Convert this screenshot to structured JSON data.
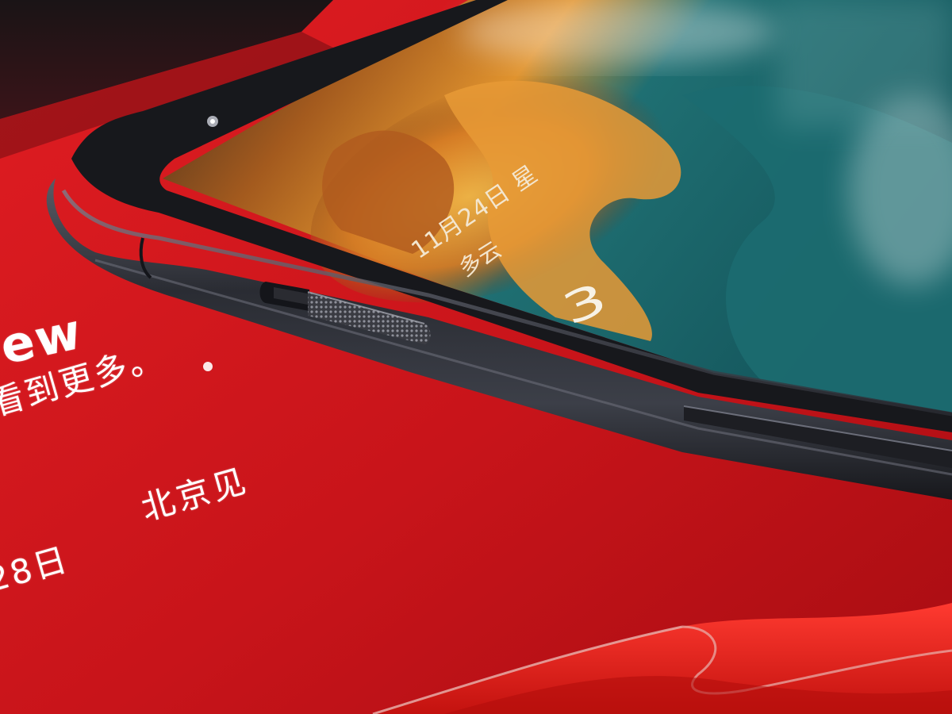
{
  "scene": {
    "description_colors": {
      "background": "#c8141a",
      "phone_frame": "#2a2c33",
      "screen_teal": "#1e6e74",
      "screen_orange": "#e08a2a"
    }
  },
  "promo": {
    "word": "ew",
    "line1": "看到更多。",
    "line2": "北京见",
    "line3": "28日"
  },
  "lockscreen": {
    "date": "11月24日 星",
    "weather": "多云",
    "clock": "3"
  }
}
